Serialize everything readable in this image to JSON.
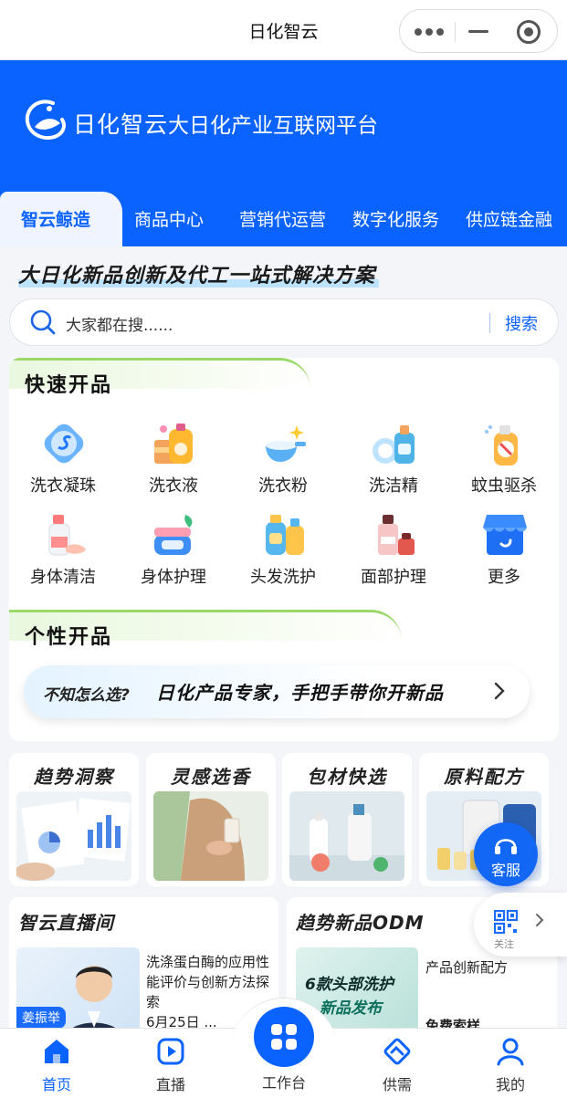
{
  "window": {
    "title": "日化智云"
  },
  "header": {
    "brand": "日化智云",
    "slogan": "大日化产业互联网平台",
    "tabs": [
      "智云鲸造",
      "商品中心",
      "营销代运营",
      "数字化服务",
      "供应链金融"
    ],
    "active_tab": 0
  },
  "headline": "大日化新品创新及代工一站式解决方案",
  "search": {
    "placeholder": "大家都在搜......",
    "button": "搜索"
  },
  "quick_start": {
    "title": "快速开品",
    "items": [
      {
        "label": "洗衣凝珠",
        "icon": "laundry-pod-icon"
      },
      {
        "label": "洗衣液",
        "icon": "laundry-liquid-icon"
      },
      {
        "label": "洗衣粉",
        "icon": "washing-powder-icon"
      },
      {
        "label": "洗洁精",
        "icon": "dish-soap-icon"
      },
      {
        "label": "蚊虫驱杀",
        "icon": "insect-repellent-icon"
      },
      {
        "label": "身体清洁",
        "icon": "body-wash-icon"
      },
      {
        "label": "身体护理",
        "icon": "body-care-icon"
      },
      {
        "label": "头发洗护",
        "icon": "hair-care-icon"
      },
      {
        "label": "面部护理",
        "icon": "face-care-icon"
      },
      {
        "label": "更多",
        "icon": "store-more-icon"
      }
    ]
  },
  "custom_start": {
    "title": "个性开品",
    "prompt_question": "不知怎么选?",
    "prompt_answer": "日化产品专家，手把手带你开新品"
  },
  "features": [
    {
      "title": "趋势洞察",
      "image": "charts-analysis-photo"
    },
    {
      "title": "灵感选香",
      "image": "perfume-photo"
    },
    {
      "title": "包材快选",
      "image": "packaging-bottles-photo"
    },
    {
      "title": "原料配方",
      "image": "raw-material-photo"
    }
  ],
  "live": {
    "title": "智云直播间",
    "host_name": "姜振举",
    "description": "洗涤蛋白酶的应用性能评价与创新方法探索",
    "date_partial": "6月25日 ..."
  },
  "odm": {
    "title": "趋势新品ODM",
    "banner_line1": "6款头部洗护",
    "banner_line2": "新品发布",
    "desc1": "产品创新配方",
    "desc2": "免费索样"
  },
  "floating": {
    "service_label": "客服",
    "follow_label": "关注"
  },
  "tabbar": {
    "items": [
      "首页",
      "直播",
      "工作台",
      "供需",
      "我的"
    ],
    "active": 0
  },
  "colors": {
    "primary": "#0b63ff",
    "accent_green": "#9bd86a",
    "background": "#f3f5f9"
  }
}
